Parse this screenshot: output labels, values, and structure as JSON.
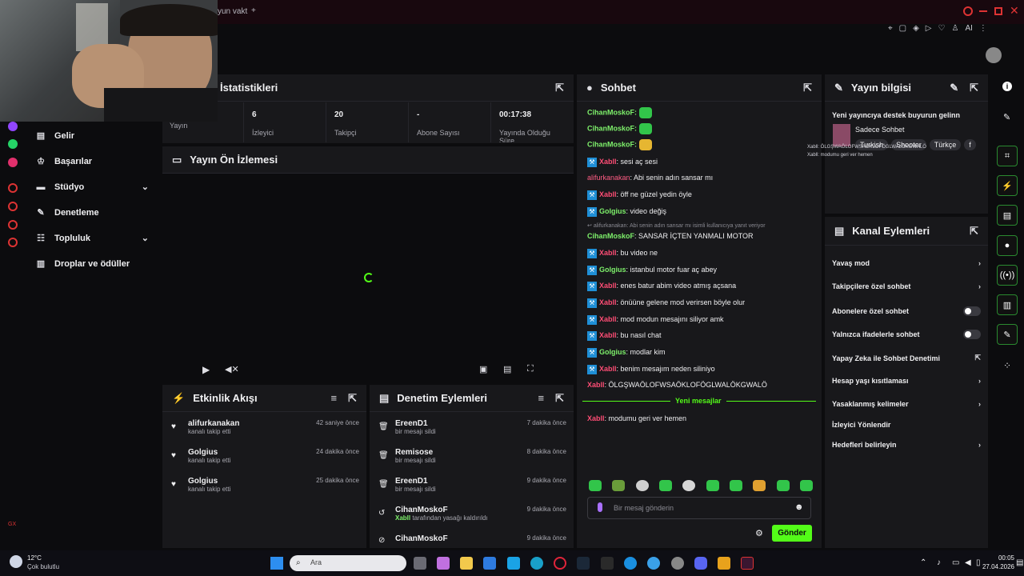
{
  "colors": {
    "accent_green": "#53fc18",
    "chat_blue": "#1f8fd6",
    "danger": "#ff4d75"
  },
  "browser": {
    "tab_title": "yun vakt",
    "new_tab": "+"
  },
  "sidebar": {
    "items": [
      {
        "label": "Gelir",
        "icon": "dollar-icon"
      },
      {
        "label": "Başarılar",
        "icon": "trophy-icon"
      },
      {
        "label": "Stüdyo",
        "icon": "studio-icon",
        "chevron": "chevron-down-icon"
      },
      {
        "label": "Denetleme",
        "icon": "wrench-icon"
      },
      {
        "label": "Topluluk",
        "icon": "people-icon",
        "chevron": "chevron-down-icon"
      },
      {
        "label": "Droplar ve ödüller",
        "icon": "gift-icon"
      }
    ],
    "footer": "GX"
  },
  "stats": {
    "title": "İstatistikleri",
    "items": [
      {
        "value": "",
        "label": "Yayın"
      },
      {
        "value": "6",
        "label": "İzleyici"
      },
      {
        "value": "20",
        "label": "Takipçi"
      },
      {
        "value": "-",
        "label": "Abone Sayısı"
      },
      {
        "value": "00:17:38",
        "label": "Yayında Olduğu Süre"
      }
    ]
  },
  "preview": {
    "title": "Yayın Ön İzlemesi"
  },
  "activity": {
    "title": "Etkinlik Akışı",
    "items": [
      {
        "name": "alifurkanakan",
        "sub": "kanalı takip etti",
        "time": "42 saniye önce"
      },
      {
        "name": "Golgius",
        "sub": "kanalı takip etti",
        "time": "24 dakika önce"
      },
      {
        "name": "Golgius",
        "sub": "kanalı takip etti",
        "time": "25 dakika önce"
      }
    ]
  },
  "moderation": {
    "title": "Denetim Eylemleri",
    "items": [
      {
        "name": "EreenD1",
        "sub_highlight": "",
        "sub": "bir mesajı sildi",
        "time": "7 dakika önce"
      },
      {
        "name": "Remisose",
        "sub_highlight": "",
        "sub": "bir mesajı sildi",
        "time": "8 dakika önce"
      },
      {
        "name": "EreenD1",
        "sub_highlight": "",
        "sub": "bir mesajı sildi",
        "time": "9 dakika önce"
      },
      {
        "name": "CihanMoskoF",
        "sub_highlight": "Xabll",
        "sub": "tarafından yasağı kaldırıldı",
        "time": "9 dakika önce"
      },
      {
        "name": "CihanMoskoF",
        "sub_highlight": "",
        "sub": "",
        "time": "9 dakika önce"
      }
    ]
  },
  "chat": {
    "title": "Sohbet",
    "messages": [
      {
        "user": "CihanMoskoF",
        "text": "",
        "emote": true
      },
      {
        "user": "CihanMoskoF",
        "text": "",
        "emote": true
      },
      {
        "user": "CihanMoskoF",
        "text": "",
        "emote": true
      },
      {
        "user": "Xabll",
        "text": ": sesi aç sesi"
      },
      {
        "user": "alifurkanakan",
        "text": ": Abi senin adın sansar mı"
      },
      {
        "user": "Xabll",
        "text": ": öff ne güzel yedin öyle"
      },
      {
        "user": "Golgius",
        "text": ": video değiş"
      },
      {
        "reply": "alifurkanakan: Abi senin adın sansar mı isimli kullanıcıya yanıt veriyor"
      },
      {
        "user": "CihanMoskoF",
        "text": ": SANSAR İÇTEN YANMALI MOTOR"
      },
      {
        "user": "Xabll",
        "text": ": bu video ne"
      },
      {
        "user": "Golgius",
        "text": ": istanbul motor fuar aç abey"
      },
      {
        "user": "Xabll",
        "text": ": enes batur abim video atmış açsana"
      },
      {
        "user": "Xabll",
        "text": ": önüüne gelene mod verirsen böyle olur"
      },
      {
        "user": "Xabll",
        "text": ": mod modun mesajını siliyor amk"
      },
      {
        "user": "Xabll",
        "text": ": bu nasıl chat"
      },
      {
        "user": "Golgius",
        "text": ": modlar kim"
      },
      {
        "user": "Xabll",
        "text": ": benim mesajım neden siliniyo"
      },
      {
        "user": "Xabll",
        "text": ": ÖLGŞWAÖLOFWSAÖKLOFÖGLWALÖKGWALÖ"
      }
    ],
    "new_messages": "Yeni mesajlar",
    "after": {
      "user": "Xabll",
      "text": ": modumu geri ver hemen"
    },
    "input_placeholder": "Bir mesaj gönderin",
    "send": "Gönder"
  },
  "stream_info": {
    "title": "Yayın bilgisi",
    "headline": "Yeni yayıncıya destek buyurun gelinn",
    "category": "Sadece Sohbet",
    "tags": [
      "Turkish",
      "Shooter",
      "Türkçe",
      "f"
    ],
    "overlay_line1": "Xabll: ÖLGŞWAÖLOFWSAÖKLOFÖGLWALÖKGWALÖ",
    "overlay_line2": "Xabll: modumu geri ver hemen"
  },
  "channel_actions": {
    "title": "Kanal Eylemleri",
    "items": [
      {
        "label": "Yavaş mod",
        "control": "chevron"
      },
      {
        "label": "Takipçilere özel sohbet",
        "control": "chevron"
      },
      {
        "label": "Abonelere özel sohbet",
        "control": "toggle"
      },
      {
        "label": "Yalnızca ifadelerle sohbet",
        "control": "toggle"
      },
      {
        "label": "Yapay Zeka ile Sohbet Denetimi",
        "control": "external"
      },
      {
        "label": "Hesap yaşı kısıtlaması",
        "control": "chevron"
      },
      {
        "label": "Yasaklanmış kelimeler",
        "control": "chevron"
      },
      {
        "label": "İzleyici Yönlendir",
        "control": "none"
      },
      {
        "label": "Hedefleri belirleyin",
        "control": "chevron"
      }
    ]
  },
  "taskbar": {
    "weather_temp": "12°C",
    "weather_desc": "Çok bulutlu",
    "search": "Ara",
    "time": "00:05",
    "date": "27.04.2026"
  }
}
